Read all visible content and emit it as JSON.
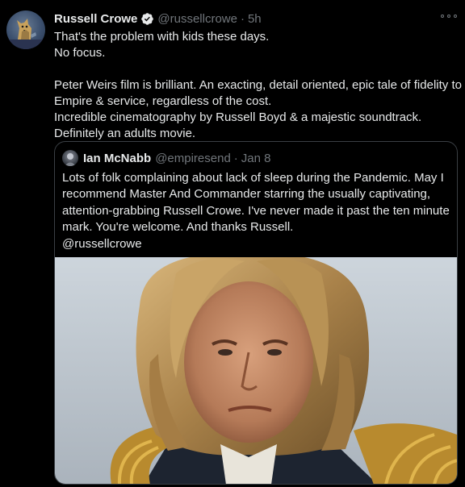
{
  "tweet": {
    "author": {
      "display_name": "Russell Crowe",
      "handle": "@russellcrowe",
      "verified": true,
      "avatar_icon": "dog-avatar-icon"
    },
    "separator": "·",
    "time": "5h",
    "more_icon": "more-options-icon",
    "text_lines": [
      "That's the problem with kids these days.",
      "No focus.",
      "",
      "Peter Weirs film is brilliant. An exacting, detail oriented, epic tale of fidelity to",
      "Empire & service, regardless of the cost.",
      "Incredible cinematography by Russell Boyd & a majestic soundtrack.",
      "Definitely an adults movie."
    ]
  },
  "quote": {
    "author": {
      "display_name": "Ian McNabb",
      "handle": "@empiresend",
      "avatar_icon": "person-avatar-icon"
    },
    "separator": "·",
    "time": "Jan 8",
    "text_lines": [
      "Lots of folk complaining about lack of sleep during the Pandemic. May I",
      "recommend Master And Commander starring the usually captivating,",
      "attention-grabbing Russell Crowe. I've never made it past the ten minute",
      "mark. You're welcome. And thanks Russell.",
      "@russellcrowe"
    ],
    "media": {
      "type": "photo",
      "subject": "long-haired man in naval coat with gold epaulettes"
    }
  },
  "colors": {
    "background": "#000000",
    "primary_text": "#e7e9ea",
    "secondary_text": "#71767b",
    "verified_badge": "#e7e9ea",
    "border": "#3a3f44"
  }
}
